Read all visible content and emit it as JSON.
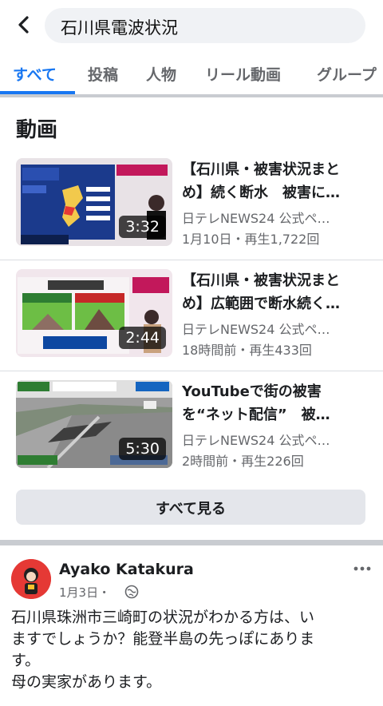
{
  "search": {
    "query": "石川県電波状況"
  },
  "tabs": [
    "すべて",
    "投稿",
    "人物",
    "リール動画",
    "グループ"
  ],
  "section_title": "動画",
  "videos": [
    {
      "title_l1": "【石川県・被害状況まと",
      "title_l2": "め】続く断水　被害に…",
      "source": "日テレNEWS24 公式ペ…",
      "meta": "1月10日・再生1,722回",
      "duration": "3:32"
    },
    {
      "title_l1": "【石川県・被害状況まと",
      "title_l2": "め】広範囲で断水続く…",
      "source": "日テレNEWS24 公式ペ…",
      "meta": "18時間前・再生433回",
      "duration": "2:44"
    },
    {
      "title_l1": "YouTubeで街の被害",
      "title_l2": "を“ネット配信”　被…",
      "source": "日テレNEWS24 公式ペ…",
      "meta": "2時間前・再生226回",
      "duration": "5:30"
    }
  ],
  "see_all_label": "すべて見る",
  "post": {
    "author": "Ayako Katakura",
    "date": "1月3日・",
    "lines": [
      "石川県珠洲市三崎町の状況がわかる方は、い",
      "ますでしょうか？能登半島の先っぽにありま",
      "す。",
      "母の実家があります。"
    ]
  },
  "colors": {
    "accent": "#1877f2",
    "muted": "#65676b"
  },
  "icons": {
    "back": "chevron-left-icon",
    "more": "more-horizontal-icon",
    "audience": "globe-icon"
  }
}
